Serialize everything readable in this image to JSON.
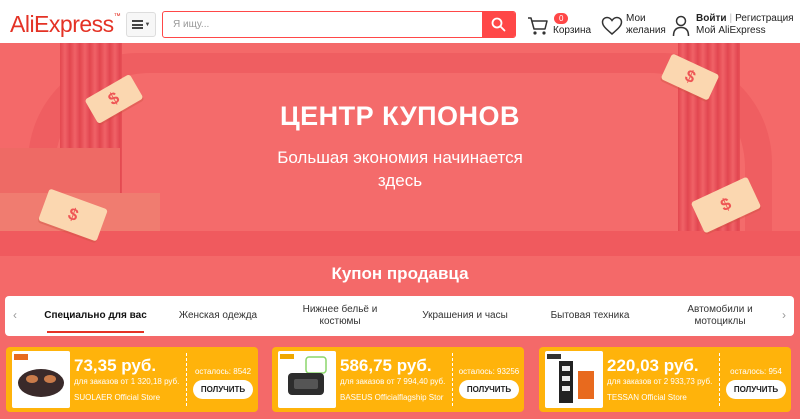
{
  "header": {
    "logo_text": "AliExpress",
    "logo_mark": "™",
    "search_placeholder": "Я ищу...",
    "cart_count": "0",
    "cart_label": "Корзина",
    "wishlist_line1": "Мои",
    "wishlist_line2": "желания",
    "login_label": "Войти",
    "register_label": "Регистрация",
    "my_account_label": "Мой AliExpress",
    "accent_color": "#ff4747"
  },
  "banner": {
    "title": "ЦЕНТР КУПОНОВ",
    "subtitle_line1": "Большая экономия начинается",
    "subtitle_line2": "здесь",
    "background_color": "#f46969"
  },
  "seller_coupons": {
    "title": "Купон продавца",
    "tabs": [
      {
        "label": "Специально для вас",
        "active": true
      },
      {
        "label": "Женская одежда",
        "active": false
      },
      {
        "label": "Нижнее бельё и костюмы",
        "active": false
      },
      {
        "label": "Украшения и часы",
        "active": false
      },
      {
        "label": "Бытовая техника",
        "active": false
      },
      {
        "label": "Автомобили и мотоциклы",
        "active": false
      }
    ],
    "prev_arrow": "‹",
    "next_arrow": "›",
    "cards": [
      {
        "price": "73,35 руб.",
        "min_order": "для заказов от 1 320,18 руб.",
        "store": "SUOLAER Official Store",
        "remaining": "осталось: 8542",
        "button": "ПОЛУЧИТЬ"
      },
      {
        "price": "586,75 руб.",
        "min_order": "для заказов от 7 994,40 руб.",
        "store": "BASEUS Officialflagship Stor",
        "remaining": "осталось: 93256",
        "button": "ПОЛУЧИТЬ"
      },
      {
        "price": "220,03 руб.",
        "min_order": "для заказов от 2 933,73 руб.",
        "store": "TESSAN Official Store",
        "remaining": "осталось: 954",
        "button": "ПОЛУЧИТЬ"
      }
    ],
    "card_color": "#ffb30b"
  }
}
